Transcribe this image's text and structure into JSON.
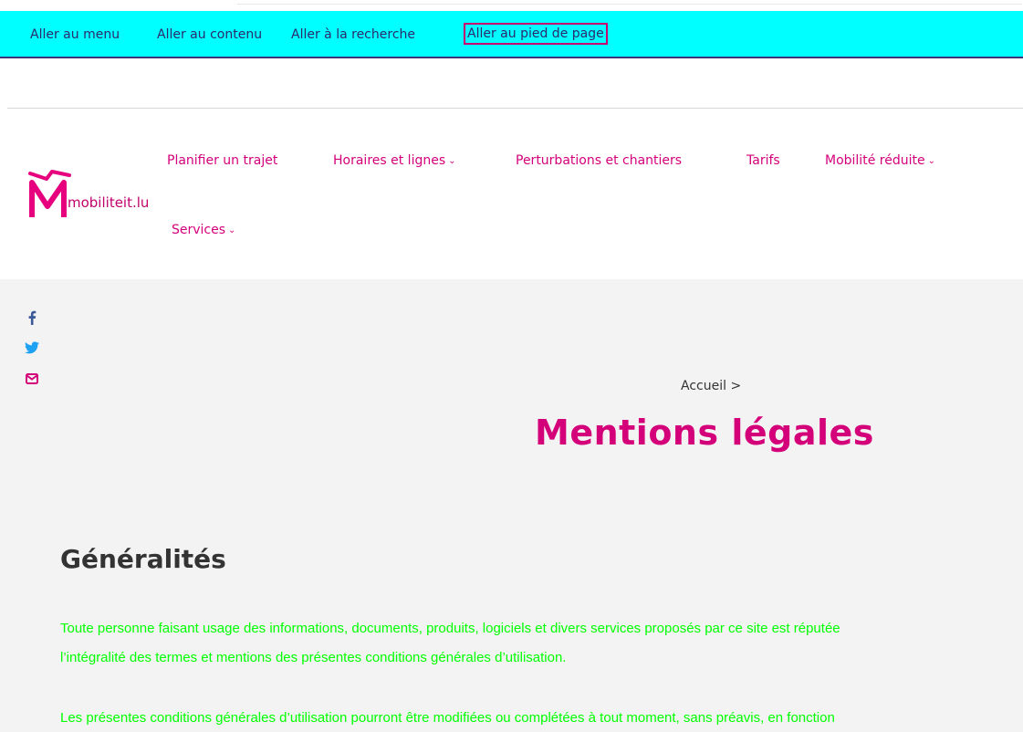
{
  "skip_links": [
    "Aller au menu",
    "Aller au contenu",
    "Aller à la recherche",
    "Aller au pied de page"
  ],
  "logo": {
    "text": "mobiliteit.lu"
  },
  "nav": {
    "items": [
      {
        "label": "Planifier un trajet"
      },
      {
        "label": "Horaires et lignes"
      },
      {
        "label": "Perturbations et chantiers"
      },
      {
        "label": "Tarifs"
      },
      {
        "label": "Mobilité réduite"
      },
      {
        "label": "Services"
      }
    ]
  },
  "social": [
    {
      "icon": "facebook-icon",
      "color": "#3b5998"
    },
    {
      "icon": "twitter-icon",
      "color": "#1da1f2"
    },
    {
      "icon": "mail-icon",
      "color": "#d4007a"
    }
  ],
  "breadcrumb": {
    "home": "Accueil",
    "separator": ">"
  },
  "page_title": "Mentions légales",
  "section": {
    "title": "Généralités",
    "paragraphs": [
      "Toute personne faisant usage des informations, documents, produits, logiciels et divers services proposés par ce site est réputée",
      "l’intégralité des termes et mentions des présentes conditions générales d’utilisation.",
      "Les présentes conditions générales d’utilisation pourront être modifiées ou complétées à tout moment, sans préavis, en fonction"
    ]
  },
  "colors": {
    "skip_bar_bg": "#00ffff",
    "brand_pink": "#d4007a",
    "body_text_green": "#00ff00"
  }
}
